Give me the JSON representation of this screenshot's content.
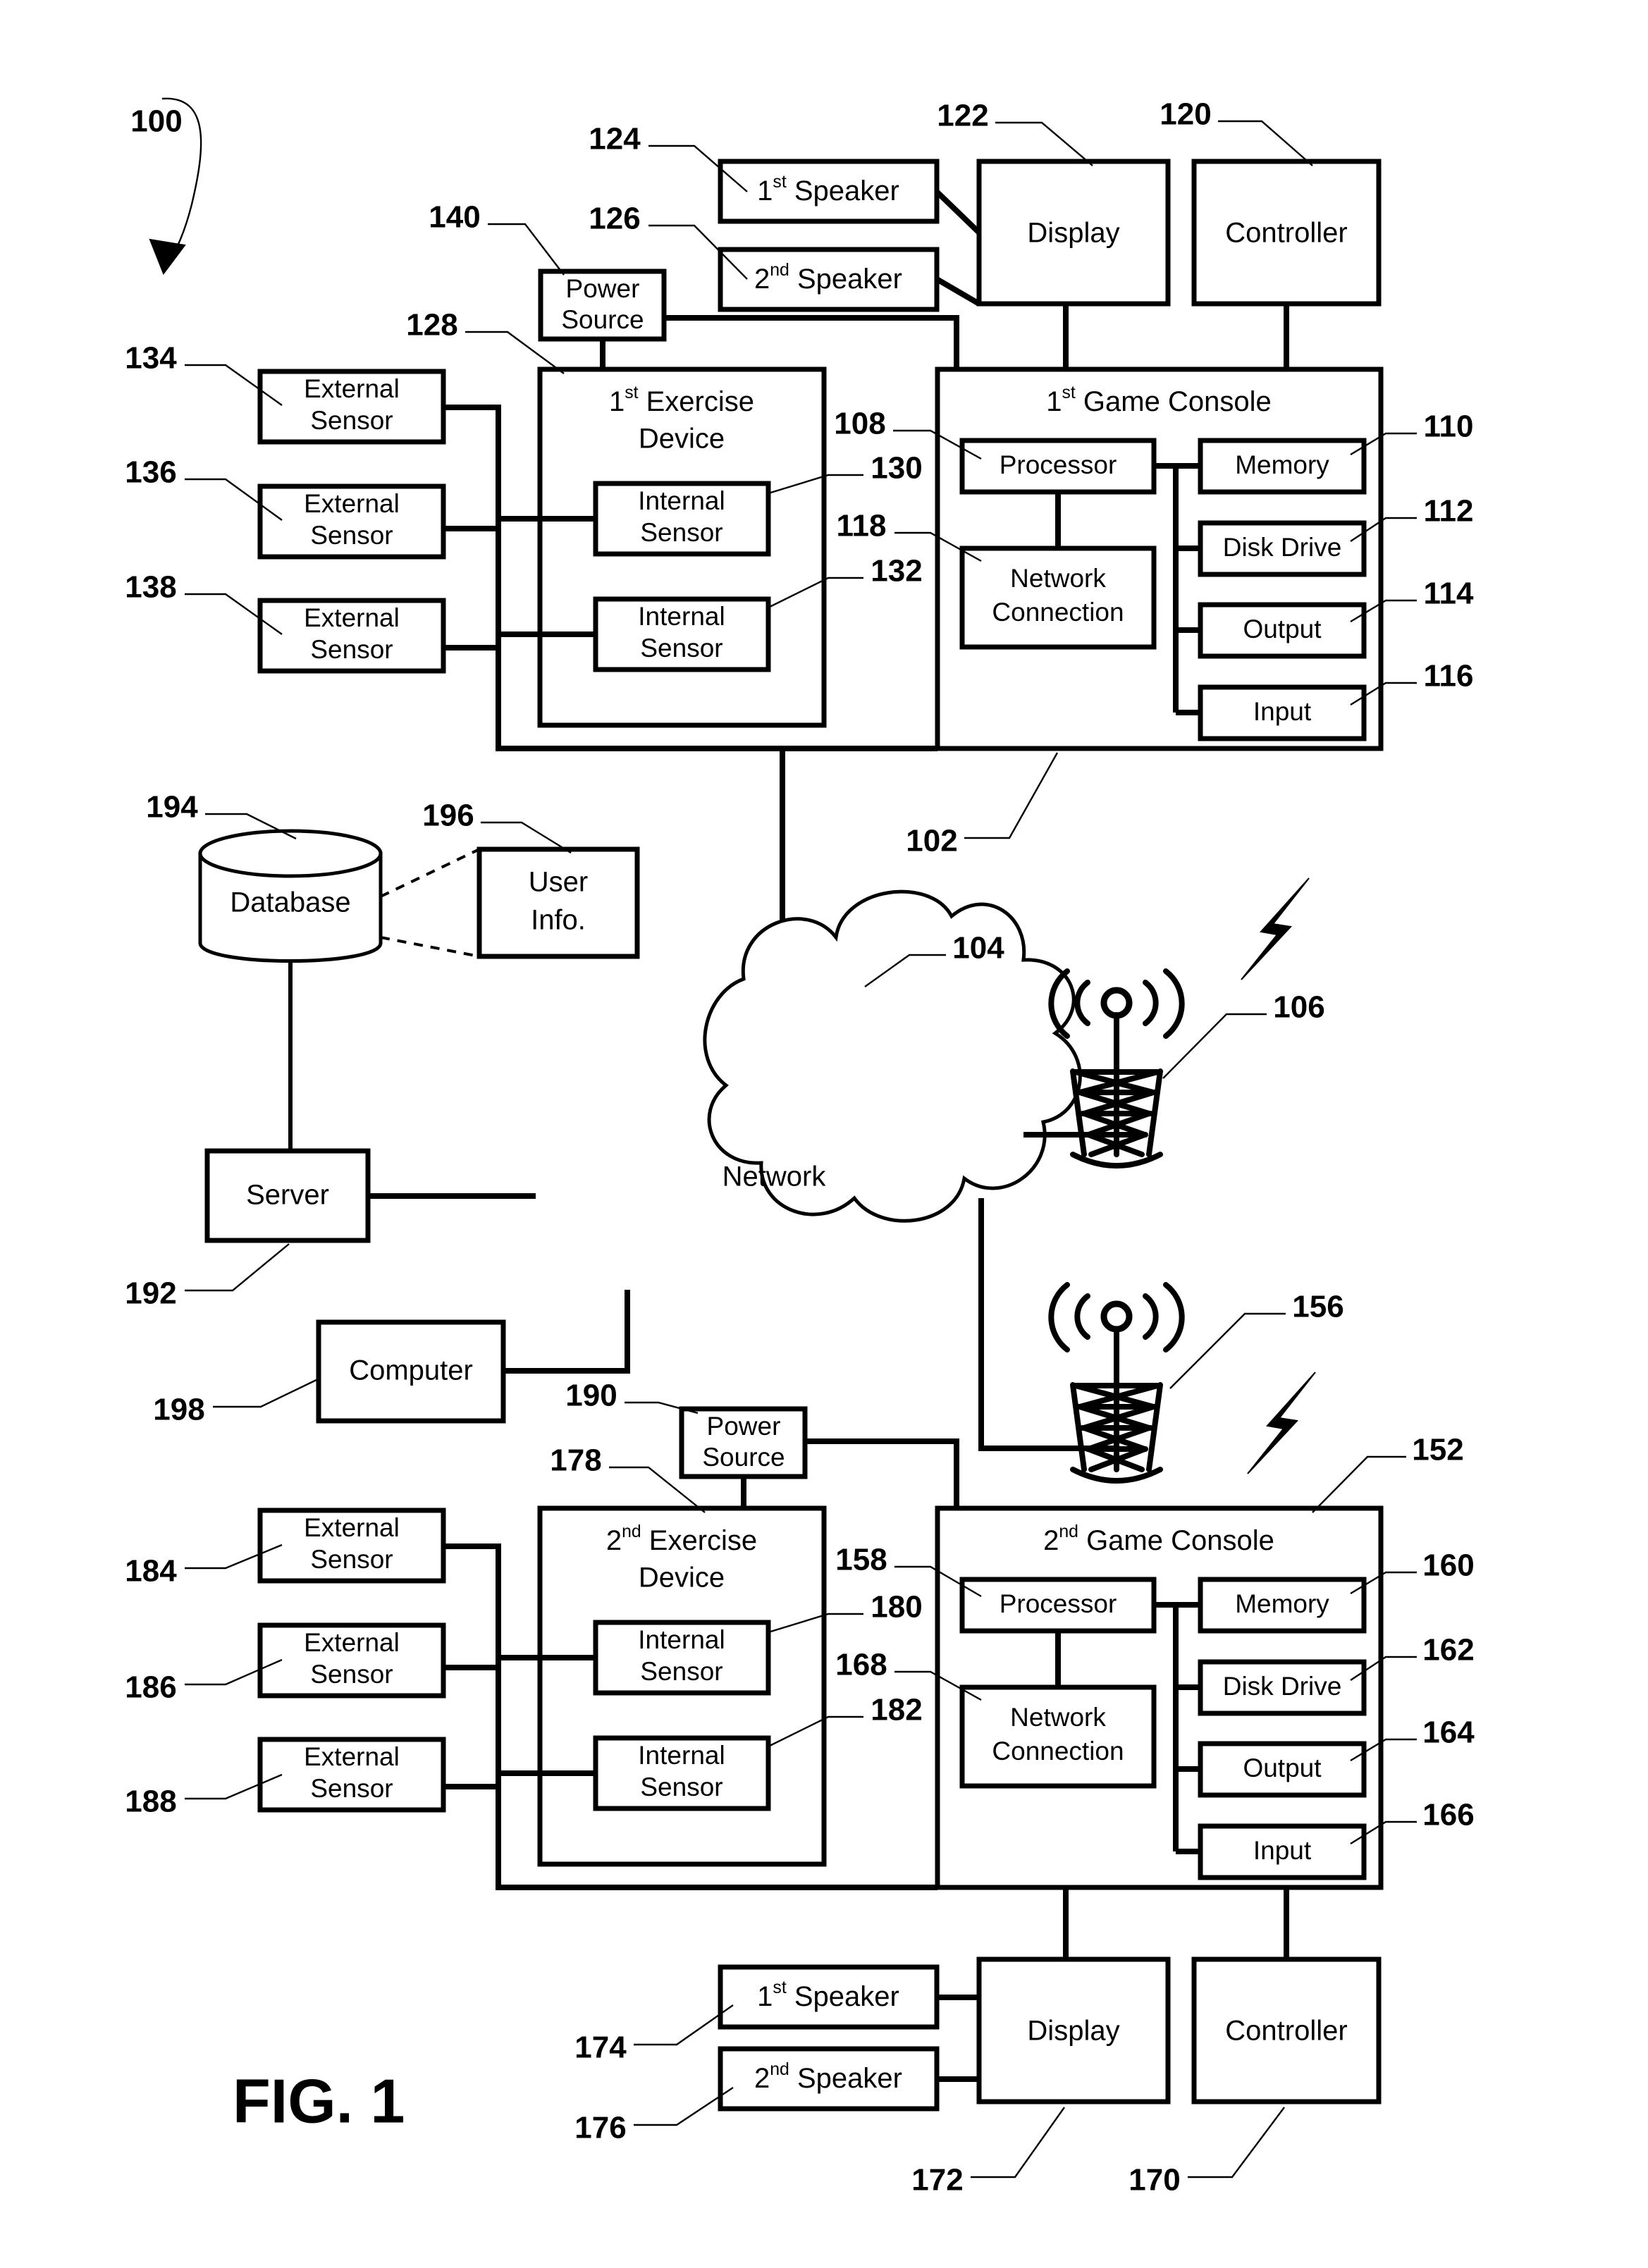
{
  "figure": {
    "label": "FIG. 1",
    "system_ref": "100"
  },
  "nodes": {
    "speaker1_top": {
      "label": "1st Speaker",
      "prefix": "1",
      "sup": "st",
      "rest": " Speaker",
      "ref": "124"
    },
    "speaker2_top": {
      "label": "2nd Speaker",
      "prefix": "2",
      "sup": "nd",
      "rest": " Speaker",
      "ref": "126"
    },
    "display_top": {
      "label": "Display",
      "ref": "122"
    },
    "controller_top": {
      "label": "Controller",
      "ref": "120"
    },
    "power_source_top": {
      "label_line1": "Power",
      "label_line2": "Source",
      "ref": "140"
    },
    "exercise_device_1": {
      "prefix": "1",
      "sup": "st",
      "rest": " Exercise",
      "label_line2": "Device",
      "ref": "128"
    },
    "game_console_1": {
      "prefix": "1",
      "sup": "st",
      "rest": " Game Console",
      "ref": "102"
    },
    "processor_1": {
      "label": "Processor",
      "ref": "108"
    },
    "network_connection_1": {
      "label_line1": "Network",
      "label_line2": "Connection",
      "ref": "118"
    },
    "memory_1": {
      "label": "Memory",
      "ref": "110"
    },
    "disk_drive_1": {
      "label": "Disk Drive",
      "ref": "112"
    },
    "output_1": {
      "label": "Output",
      "ref": "114"
    },
    "input_1": {
      "label": "Input",
      "ref": "116"
    },
    "external_sensor_134": {
      "label_line1": "External",
      "label_line2": "Sensor",
      "ref": "134"
    },
    "external_sensor_136": {
      "label_line1": "External",
      "label_line2": "Sensor",
      "ref": "136"
    },
    "external_sensor_138": {
      "label_line1": "External",
      "label_line2": "Sensor",
      "ref": "138"
    },
    "internal_sensor_130": {
      "label_line1": "Internal",
      "label_line2": "Sensor",
      "ref": "130"
    },
    "internal_sensor_132": {
      "label_line1": "Internal",
      "label_line2": "Sensor",
      "ref": "132"
    },
    "database": {
      "label": "Database",
      "ref": "194"
    },
    "user_info": {
      "label_line1": "User",
      "label_line2": "Info.",
      "ref": "196"
    },
    "server": {
      "label": "Server",
      "ref": "192"
    },
    "computer": {
      "label": "Computer",
      "ref": "198"
    },
    "network_cloud": {
      "label": "Network",
      "ref": "104"
    },
    "cell_tower_top": {
      "ref": "106"
    },
    "cell_tower_bottom": {
      "ref": "156"
    },
    "power_source_bottom": {
      "label_line1": "Power",
      "label_line2": "Source",
      "ref": "190"
    },
    "exercise_device_2": {
      "prefix": "2",
      "sup": "nd",
      "rest": " Exercise",
      "label_line2": "Device",
      "ref": "178"
    },
    "game_console_2": {
      "prefix": "2",
      "sup": "nd",
      "rest": " Game Console",
      "ref": "152"
    },
    "processor_2": {
      "label": "Processor",
      "ref": "158"
    },
    "network_connection_2": {
      "label_line1": "Network",
      "label_line2": "Connection",
      "ref": "168"
    },
    "memory_2": {
      "label": "Memory",
      "ref": "160"
    },
    "disk_drive_2": {
      "label": "Disk Drive",
      "ref": "162"
    },
    "output_2": {
      "label": "Output",
      "ref": "164"
    },
    "input_2": {
      "label": "Input",
      "ref": "166"
    },
    "external_sensor_184": {
      "label_line1": "External",
      "label_line2": "Sensor",
      "ref": "184"
    },
    "external_sensor_186": {
      "label_line1": "External",
      "label_line2": "Sensor",
      "ref": "186"
    },
    "external_sensor_188": {
      "label_line1": "External",
      "label_line2": "Sensor",
      "ref": "188"
    },
    "internal_sensor_180": {
      "label_line1": "Internal",
      "label_line2": "Sensor",
      "ref": "180"
    },
    "internal_sensor_182": {
      "label_line1": "Internal",
      "label_line2": "Sensor",
      "ref": "182"
    },
    "speaker1_bottom": {
      "prefix": "1",
      "sup": "st",
      "rest": " Speaker",
      "ref": "174"
    },
    "speaker2_bottom": {
      "prefix": "2",
      "sup": "nd",
      "rest": " Speaker",
      "ref": "176"
    },
    "display_bottom": {
      "label": "Display",
      "ref": "172"
    },
    "controller_bottom": {
      "label": "Controller",
      "ref": "170"
    }
  },
  "colors": {
    "ink": "#000000",
    "paper": "#ffffff"
  }
}
